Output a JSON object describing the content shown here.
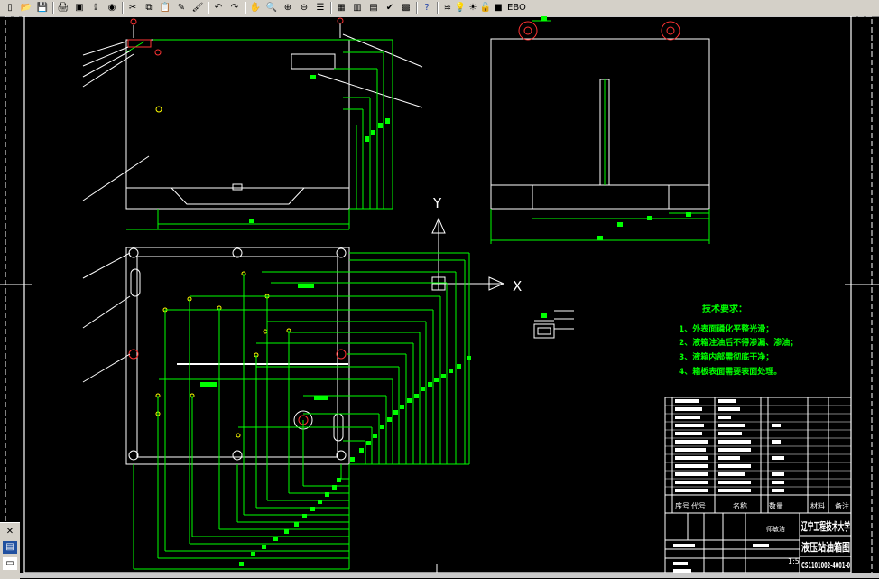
{
  "toolbar": {
    "icons": [
      "new-icon",
      "open-icon",
      "save-icon",
      "print-icon",
      "preview-icon",
      "publish-icon",
      "plot-icon",
      "cut-icon",
      "copy-icon",
      "paste-icon",
      "matchprop-icon",
      "brush-icon",
      "undo-icon",
      "redo-icon",
      "pan-icon",
      "zoom-realtime-icon",
      "zoom-window-icon",
      "zoom-previous-icon",
      "properties-icon",
      "designcenter-icon",
      "toolpalette-icon",
      "sheetset-icon",
      "markup-icon",
      "calculator-icon",
      "help-icon",
      "layer-manager-icon",
      "lightbulb-icon",
      "sun-icon",
      "lock-icon",
      "color-icon"
    ],
    "layer_name": "EBO"
  },
  "drawing": {
    "axis_y": "Y",
    "axis_x": "X",
    "tech_requirements": {
      "title": "技术要求：",
      "items": [
        "1、外表面磷化平整光滑；",
        "2、液箱注油后不得渗漏、渗油；",
        "3、液箱内部需彻底干净；",
        "4、箱板表面需要表面处理。"
      ]
    },
    "title_block": {
      "school": "辽宁工程技术大学",
      "drawing_name": "液压站油箱图",
      "drawing_number": "CS1101002-4001-0",
      "scale": "1:5",
      "header_cols": [
        "序号",
        "代号",
        "名称",
        "数量",
        "材料",
        "备注"
      ],
      "label_designer": "师敏洁"
    }
  },
  "colors": {
    "green": "#00ff00",
    "white": "#ffffff",
    "red": "#ff3333",
    "yellow": "#ffff00"
  }
}
